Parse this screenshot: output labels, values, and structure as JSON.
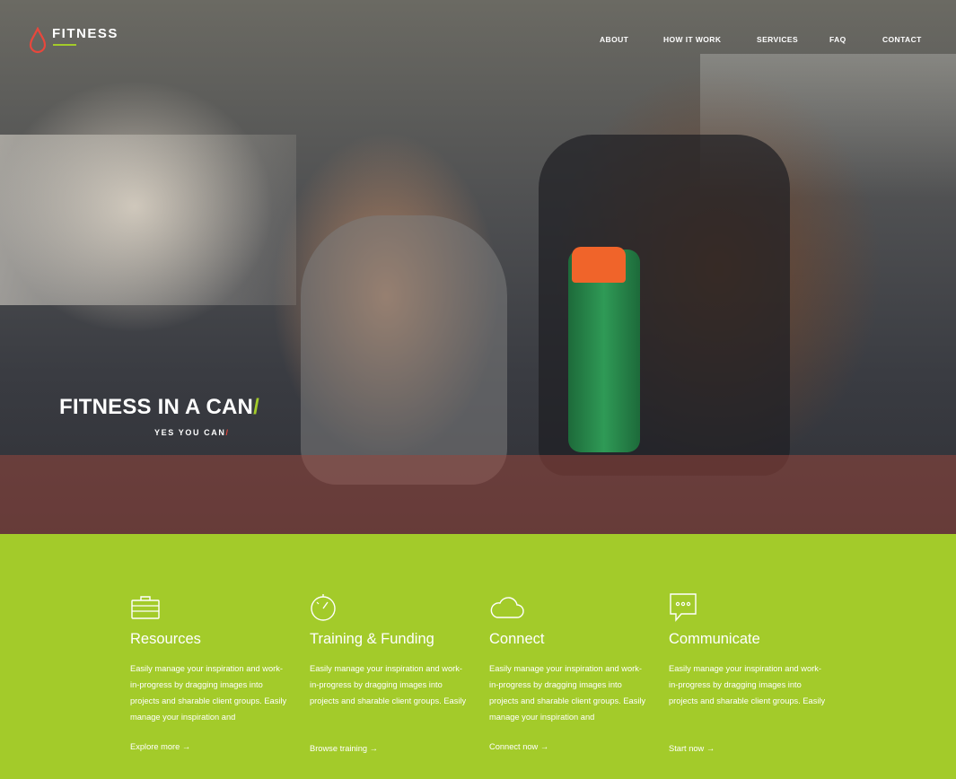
{
  "brand": {
    "name": "FITNESS"
  },
  "nav": {
    "items": [
      {
        "label": "ABOUT"
      },
      {
        "label": "HOW IT WORK"
      },
      {
        "label": "SERVICES"
      },
      {
        "label": "FAQ"
      },
      {
        "label": "CONTACT"
      }
    ]
  },
  "hero": {
    "title": "FITNESS IN A CAN",
    "title_slash": "/",
    "subtitle": "YES YOU CAN",
    "subtitle_slash": "/"
  },
  "features": [
    {
      "icon": "briefcase-icon",
      "title": "Resources",
      "text": "Easily manage your inspiration and work-in-progress by dragging images into projects and sharable client groups. Easily manage your inspiration and",
      "link": "Explore more →"
    },
    {
      "icon": "stopwatch-icon",
      "title": "Training & Funding",
      "text": "Easily manage your inspiration and work-in-progress by dragging images into projects and sharable client groups. Easily",
      "link": "Browse training →"
    },
    {
      "icon": "cloud-icon",
      "title": "Connect",
      "text": "Easily manage your inspiration and work-in-progress by dragging images into projects and sharable client groups. Easily manage your inspiration and",
      "link": "Connect now →"
    },
    {
      "icon": "chat-bubble-icon",
      "title": "Communicate",
      "text": "Easily manage your inspiration and work-in-progress by dragging images into projects and sharable client groups. Easily",
      "link": "Start now →"
    }
  ],
  "colors": {
    "accent_green": "#a3cb2a",
    "accent_red": "#e8473c",
    "text_white": "#ffffff"
  }
}
